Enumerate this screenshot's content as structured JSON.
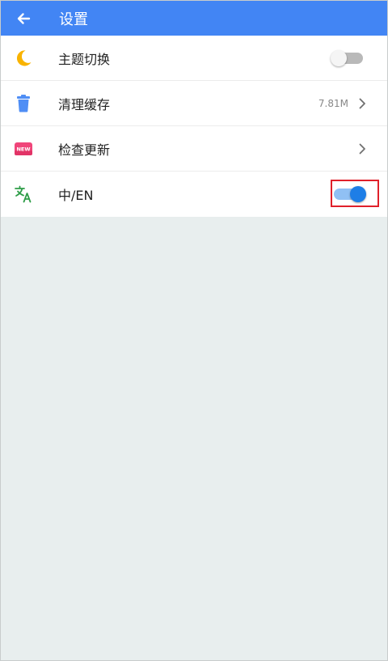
{
  "appbar": {
    "title": "设置",
    "back_icon": "arrow-left-icon",
    "background": "#4285f4"
  },
  "settings": {
    "items": [
      {
        "label": "主题切换",
        "icon": "moon-icon",
        "control": "toggle",
        "enabled": false
      },
      {
        "label": "清理缓存",
        "icon": "trash-icon",
        "control": "chevron",
        "value": "7.81M"
      },
      {
        "label": "检查更新",
        "icon": "new-badge-icon",
        "icon_text": "NEW",
        "control": "chevron"
      },
      {
        "label": "中/EN",
        "icon": "translate-icon",
        "control": "toggle",
        "enabled": true
      }
    ]
  },
  "colors": {
    "accent": "#4285f4",
    "moon": "#f9b300",
    "trash": "#4f8ef5",
    "new_badge": "#f0457a",
    "translate": "#2e9d48",
    "toggle_on": "#1e7ee6",
    "highlight": "#e0202a"
  }
}
